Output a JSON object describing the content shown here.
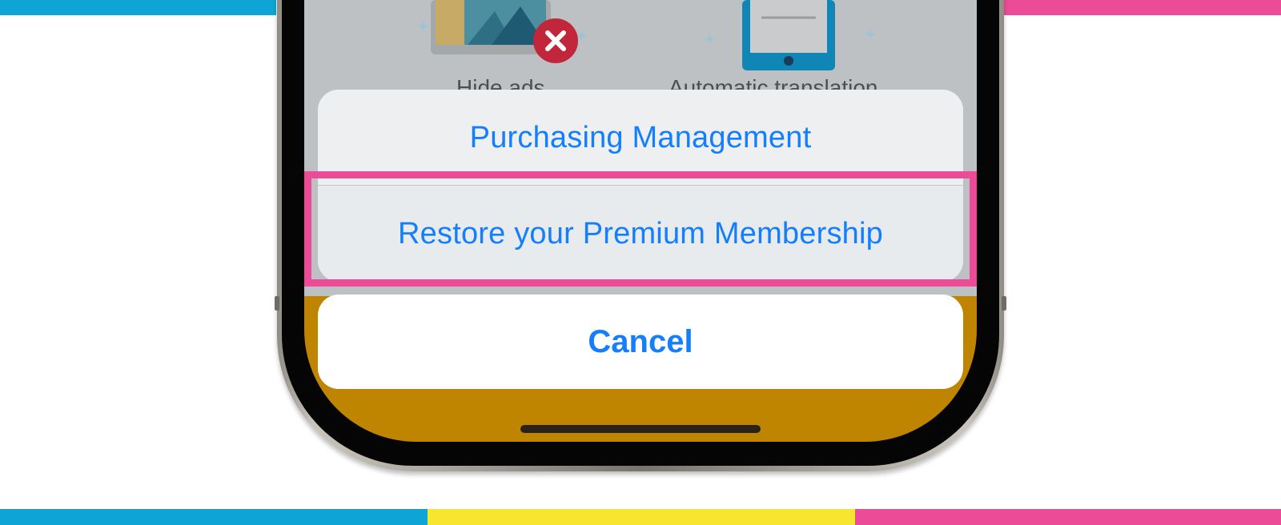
{
  "background_labels": {
    "left": "Hide ads",
    "right": "Automatic translation"
  },
  "action_sheet": {
    "items": [
      {
        "label": "Purchasing Management"
      },
      {
        "label": "Restore your Premium Membership"
      }
    ],
    "cancel_label": "Cancel"
  },
  "colors": {
    "accent_blue": "#157efb",
    "highlight_pink": "#ec4c97",
    "stripe_blue": "#0ea5d6",
    "stripe_yellow": "#f6e630",
    "screen_gold": "#bf8500"
  },
  "icons": {
    "close_badge": "close-icon",
    "photo_illustration": "image-icon",
    "tablet_illustration": "tablet-icon"
  }
}
